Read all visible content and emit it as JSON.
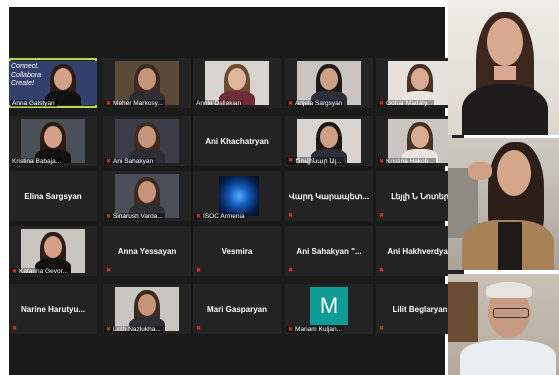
{
  "gallery": {
    "tiles": [
      {
        "kind": "video",
        "label": "Anna Galstyan",
        "muted": false,
        "active": true,
        "banner": [
          "Connect.",
          "Collabora",
          "Create!"
        ]
      },
      {
        "kind": "video",
        "label": "Meher Markosy...",
        "muted": true
      },
      {
        "kind": "video",
        "label": "Annie Dallakian",
        "muted": false
      },
      {
        "kind": "video",
        "label": "Anjela Sargsyan",
        "muted": true
      },
      {
        "kind": "video",
        "label": "Gohar Madaty...",
        "muted": true
      },
      {
        "kind": "video",
        "label": "Kristina Babaja...",
        "muted": false
      },
      {
        "kind": "video",
        "label": "Ani Sahakyan",
        "muted": true
      },
      {
        "kind": "name",
        "name": "Ani Khachatryan",
        "muted": false
      },
      {
        "kind": "video",
        "label": "Ծովինար Ալ...",
        "muted": true
      },
      {
        "kind": "video",
        "label": "Kristina Hakob...",
        "muted": true
      },
      {
        "kind": "name",
        "name": "Elina Sargsyan",
        "muted": false
      },
      {
        "kind": "video",
        "label": "Sinarush Varda...",
        "muted": true
      },
      {
        "kind": "image",
        "label": "ISOC Armenia",
        "muted": true
      },
      {
        "kind": "name",
        "name": "Վարդ Կարապետ...",
        "muted": true
      },
      {
        "kind": "name",
        "name": "Լեյլի Ն Նոտեր",
        "muted": true
      },
      {
        "kind": "video",
        "label": "Katarina Gevor...",
        "muted": true
      },
      {
        "kind": "name",
        "name": "Anna Yessayan",
        "muted": true
      },
      {
        "kind": "name",
        "name": "Vesmira",
        "muted": true
      },
      {
        "kind": "name",
        "name": "Ani Sahakyan \"...",
        "muted": true
      },
      {
        "kind": "name",
        "name": "Ani Hakhverdyan",
        "muted": true
      },
      {
        "kind": "name",
        "name": "Narine Harutyu...",
        "muted": true
      },
      {
        "kind": "video",
        "label": "Lilith Nazlukha...",
        "muted": true
      },
      {
        "kind": "name",
        "name": "Mari Gasparyan",
        "muted": true
      },
      {
        "kind": "avatar",
        "initial": "M",
        "label": "Mariam Kuljan...",
        "muted": true
      },
      {
        "kind": "name",
        "name": "Lilit Beglaryan",
        "muted": true
      }
    ]
  },
  "speakers": [
    {
      "label": "",
      "description": "woman with long dark hair, black top"
    },
    {
      "label": "",
      "description": "young woman in tan jacket"
    },
    {
      "label": "",
      "description": "older man with glasses"
    }
  ],
  "colors": {
    "grid_bg": "#1a1a1a",
    "tile_bg": "#232323",
    "active_border": "#b7d84b",
    "muted_icon": "#e0322f",
    "avatar_tile": "#0e9b95"
  }
}
